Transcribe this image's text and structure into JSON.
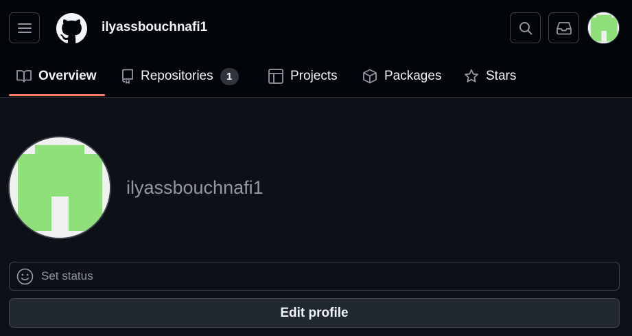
{
  "header": {
    "username": "ilyassbouchnafi1"
  },
  "tabs": [
    {
      "label": "Overview",
      "icon": "book-icon",
      "active": true
    },
    {
      "label": "Repositories",
      "icon": "repo-icon",
      "count": "1"
    },
    {
      "label": "Projects",
      "icon": "project-table-icon"
    },
    {
      "label": "Packages",
      "icon": "package-icon"
    },
    {
      "label": "Stars",
      "icon": "star-icon"
    }
  ],
  "profile": {
    "name": "ilyassbouchnafi1",
    "status_label": "Set status",
    "edit_label": "Edit profile"
  },
  "colors": {
    "background": "#0d1117",
    "header_bg": "#010409",
    "active_underline": "#f78166",
    "avatar_green": "#8fe07a"
  }
}
